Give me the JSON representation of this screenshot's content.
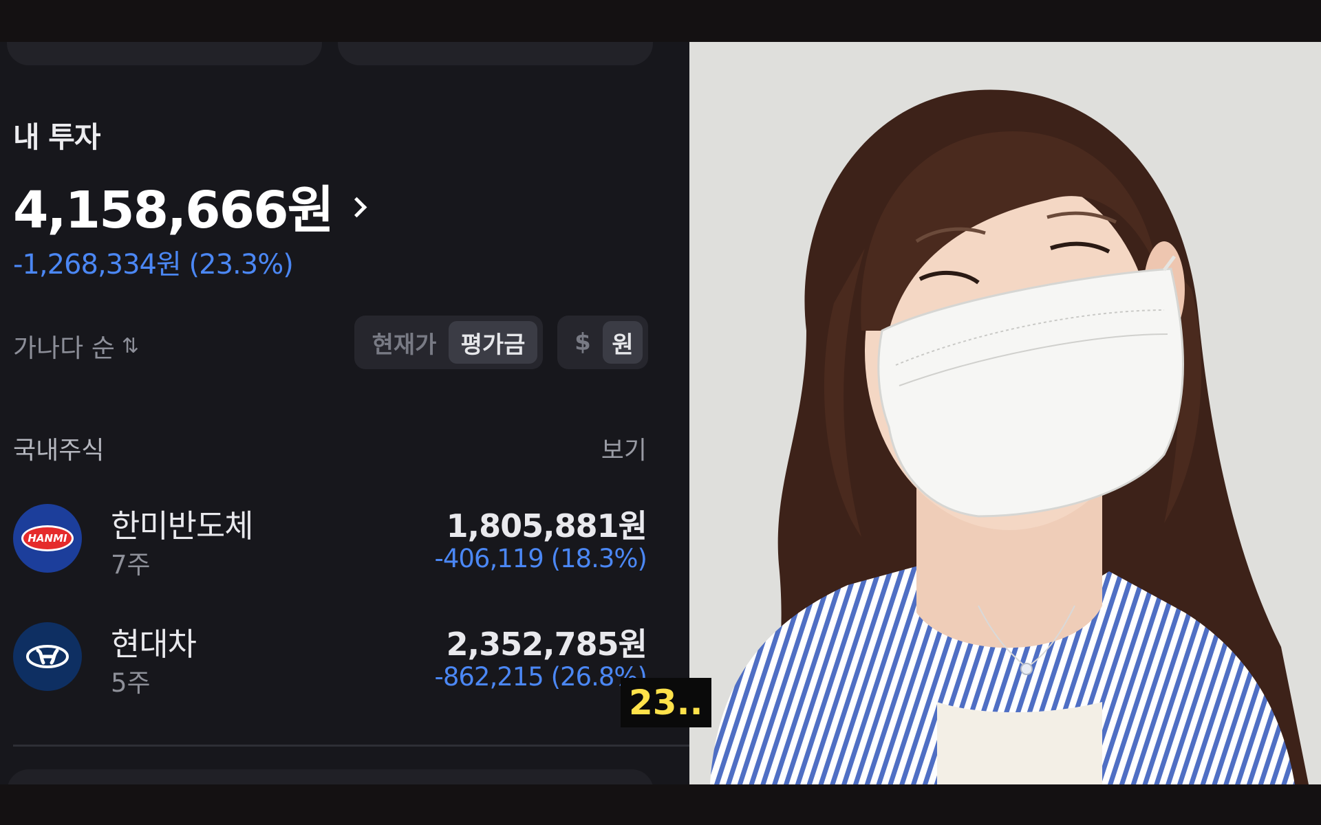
{
  "app": {
    "section_title": "내 투자",
    "total_value": "4,158,666원",
    "total_change": "-1,268,334원 (23.3%)",
    "sort_label": "가나다 순",
    "sort_icon": "sort-arrows-icon",
    "price_toggle": {
      "options": [
        "현재가",
        "평가금"
      ],
      "selected": "평가금"
    },
    "currency_toggle": {
      "options": [
        "$",
        "원"
      ],
      "selected": "원"
    },
    "category": "국내주식",
    "see_label": "보기",
    "holdings": [
      {
        "logo": "hanmi-logo",
        "logo_text": "HANMI",
        "name": "한미반도체",
        "shares": "7주",
        "value": "1,805,881원",
        "change": "-406,119 (18.3%)"
      },
      {
        "logo": "hyundai-logo",
        "name": "현대차",
        "shares": "5주",
        "value": "2,352,785원",
        "change": "-862,215 (26.8%)"
      }
    ],
    "colors": {
      "background": "#17171c",
      "loss_blue": "#4b87f4",
      "text": "#e9e9ed"
    }
  },
  "subtitle": "23..",
  "subtitle_color": "#ffe24a"
}
